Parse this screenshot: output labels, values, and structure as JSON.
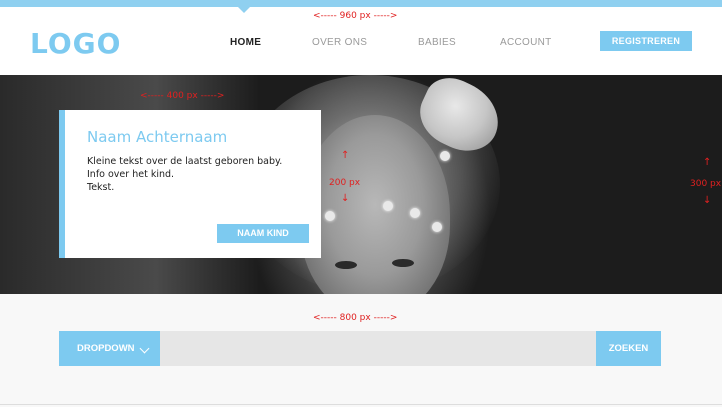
{
  "annotations": {
    "header_width": "<-----    960 px      ----->",
    "card_width": "<-----    400 px    ----->",
    "card_height": "200 px",
    "hero_height": "300 px",
    "search_width": "<-----    800 px      ----->"
  },
  "header": {
    "logo": "LOGO",
    "nav": [
      "HOME",
      "OVER ONS",
      "BABIES",
      "ACCOUNT"
    ],
    "active": "HOME",
    "register_label": "REGISTREREN"
  },
  "hero": {
    "card": {
      "title": "Naam Achternaam",
      "lines": [
        "Kleine tekst over de laatst geboren baby.",
        "Info over het kind.",
        "Tekst."
      ],
      "button_label": "NAAM KIND"
    }
  },
  "search": {
    "dropdown_label": "DROPDOWN",
    "input_value": "",
    "button_label": "ZOEKEN"
  },
  "colors": {
    "accent": "#7dcaf0",
    "annotation": "#e02020"
  },
  "icons": {
    "dropdown": "chevron-down-icon"
  }
}
